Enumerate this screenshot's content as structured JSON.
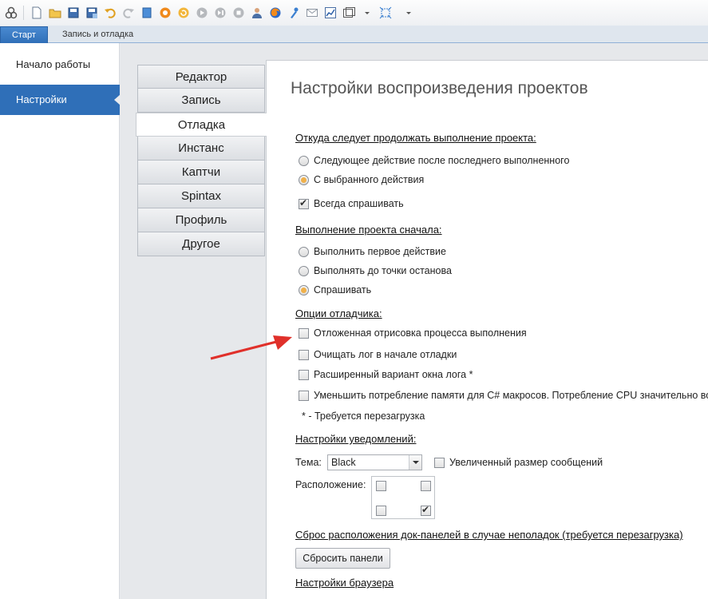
{
  "toolbar": {
    "icons": [
      "app-logo-icon",
      "new-file-icon",
      "open-folder-icon",
      "save-icon",
      "save-as-icon",
      "undo-icon",
      "redo-icon",
      "stop-icon",
      "record-icon",
      "refresh-icon",
      "play-icon",
      "step-icon",
      "stop-debug-icon",
      "user-icon",
      "firefox-icon",
      "tools-icon",
      "mail-icon",
      "chart-icon",
      "window-icon",
      "expand-icon",
      "dropdown-icon"
    ]
  },
  "ribbon": {
    "tabs": [
      "Старт",
      "Запись и отладка"
    ]
  },
  "leftnav": {
    "items": [
      "Начало работы",
      "Настройки"
    ]
  },
  "vtabs": [
    "Редактор",
    "Запись",
    "Отладка",
    "Инстанс",
    "Каптчи",
    "Spintax",
    "Профиль",
    "Другое"
  ],
  "panel": {
    "title": "Настройки воспроизведения проектов",
    "section1": {
      "heading": "Откуда следует продолжать выполнение проекта:",
      "options": [
        "Следующее действие после последнего выполненного",
        "С выбранного действия"
      ],
      "checkbox": "Всегда спрашивать"
    },
    "section2": {
      "heading": "Выполнение проекта сначала:",
      "options": [
        "Выполнить первое действие",
        "Выполнять до точки останова",
        "Спрашивать"
      ]
    },
    "section3": {
      "heading": "Опции отладчика:",
      "options": [
        "Отложенная отрисовка процесса выполнения",
        "Очищать лог в начале отладки",
        "Расширенный вариант окна лога *",
        "Уменьшить потребление памяти для C# макросов. Потребление CPU значительно воз"
      ],
      "note": "* - Требуется перезагрузка"
    },
    "section4": {
      "heading": "Настройки уведомлений:",
      "theme_label": "Тема:",
      "theme_value": "Black",
      "bigger_label": "Увеличенный размер сообщений",
      "position_label": "Расположение:"
    },
    "section5": {
      "heading": "Сброс расположения док-панелей в случае неполадок (требуется перезагрузка)",
      "button": "Сбросить панели"
    },
    "section6": {
      "heading": "Настройки браузера"
    }
  },
  "colors": {
    "accent": "#2f6fb8",
    "radio_selected": "#f0b14a",
    "annotation_arrow": "#e0302a"
  }
}
